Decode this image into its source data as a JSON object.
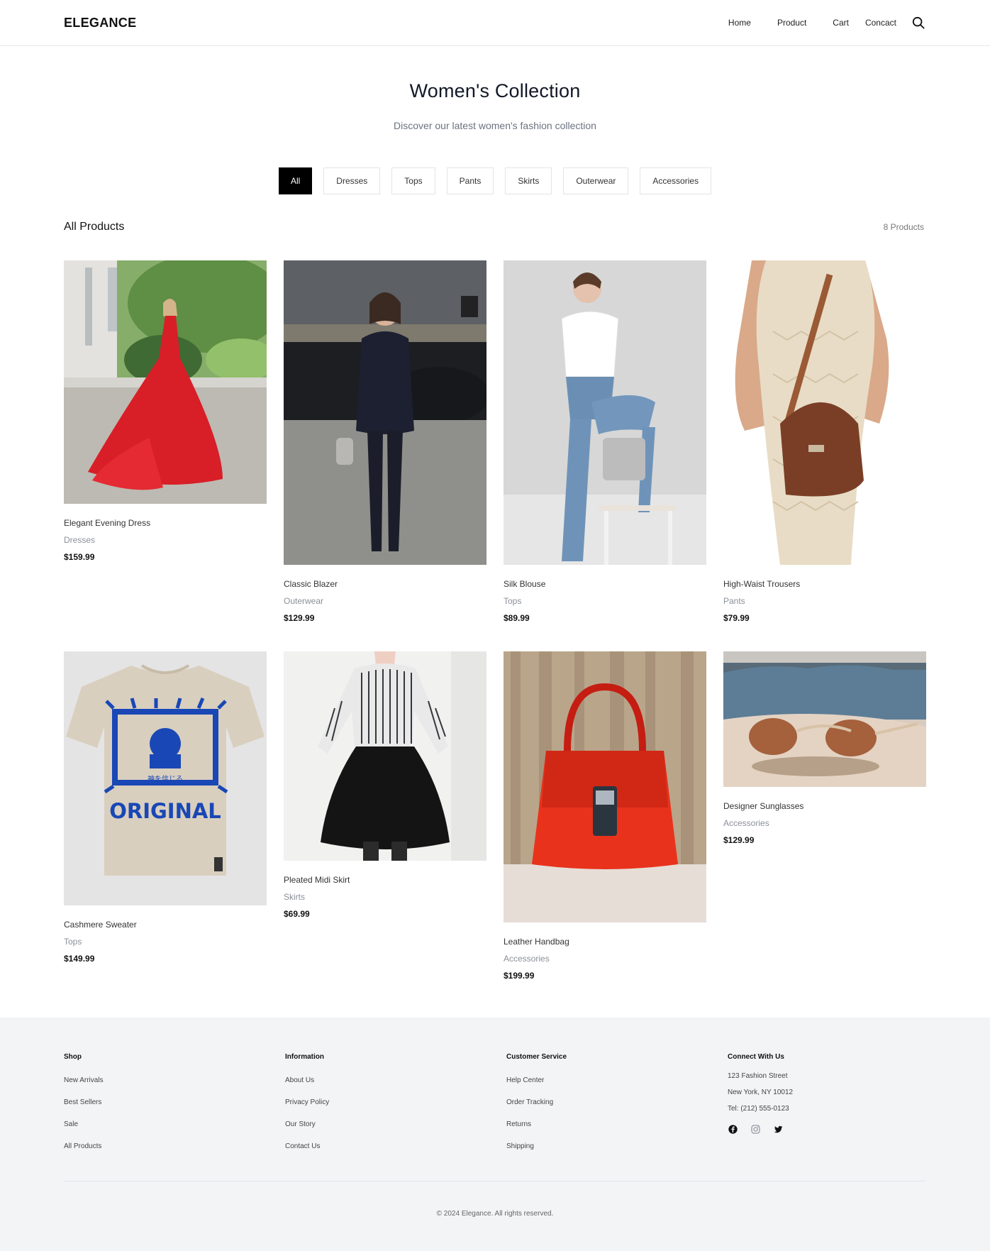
{
  "header": {
    "logo": "ELEGANCE",
    "nav": [
      "Home",
      "Product",
      "Cart",
      "Concact"
    ]
  },
  "hero": {
    "title": "Women's Collection",
    "subtitle": "Discover our latest women's fashion collection"
  },
  "filters": [
    "All",
    "Dresses",
    "Tops",
    "Pants",
    "Skirts",
    "Outerwear",
    "Accessories"
  ],
  "products_section": {
    "title": "All Products",
    "count": "8 Products"
  },
  "products": [
    {
      "name": "Elegant Evening Dress",
      "category": "Dresses",
      "price": "$159.99",
      "image": "red-evening-dress-photo"
    },
    {
      "name": "Classic Blazer",
      "category": "Outerwear",
      "price": "$129.99",
      "image": "black-suit-street-photo"
    },
    {
      "name": "Silk Blouse",
      "category": "Tops",
      "price": "$89.99",
      "image": "white-top-jeans-photo"
    },
    {
      "name": "High-Waist Trousers",
      "category": "Pants",
      "price": "$79.99",
      "image": "knit-dress-brown-bag-photo"
    },
    {
      "name": "Cashmere Sweater",
      "category": "Tops",
      "price": "$149.99",
      "image": "graphic-tshirt-photo"
    },
    {
      "name": "Pleated Midi Skirt",
      "category": "Skirts",
      "price": "$69.99",
      "image": "striped-shirt-black-skirt-photo"
    },
    {
      "name": "Leather Handbag",
      "category": "Accessories",
      "price": "$199.99",
      "image": "red-handbag-photo"
    },
    {
      "name": "Designer Sunglasses",
      "category": "Accessories",
      "price": "$129.99",
      "image": "sunglasses-beach-photo"
    }
  ],
  "tshirt_print": {
    "text": "ORIGINAL",
    "kanji": "神を信じる"
  },
  "footer": {
    "shop": {
      "title": "Shop",
      "links": [
        "New Arrivals",
        "Best Sellers",
        "Sale",
        "All Products"
      ]
    },
    "information": {
      "title": "Information",
      "links": [
        "About Us",
        "Privacy Policy",
        "Our Story",
        "Contact Us"
      ]
    },
    "service": {
      "title": "Customer Service",
      "links": [
        "Help Center",
        "Order Tracking",
        "Returns",
        "Shipping"
      ]
    },
    "connect": {
      "title": "Connect With Us",
      "address1": "123 Fashion Street",
      "address2": "New York, NY 10012",
      "phone": "Tel: (212) 555-0123",
      "socials": [
        "facebook-icon",
        "instagram-icon",
        "twitter-icon"
      ]
    },
    "copyright": "© 2024 Elegance. All rights reserved."
  },
  "colors": {
    "accent": "#000000",
    "footer_bg": "#f3f4f6",
    "muted": "#6b7280"
  }
}
